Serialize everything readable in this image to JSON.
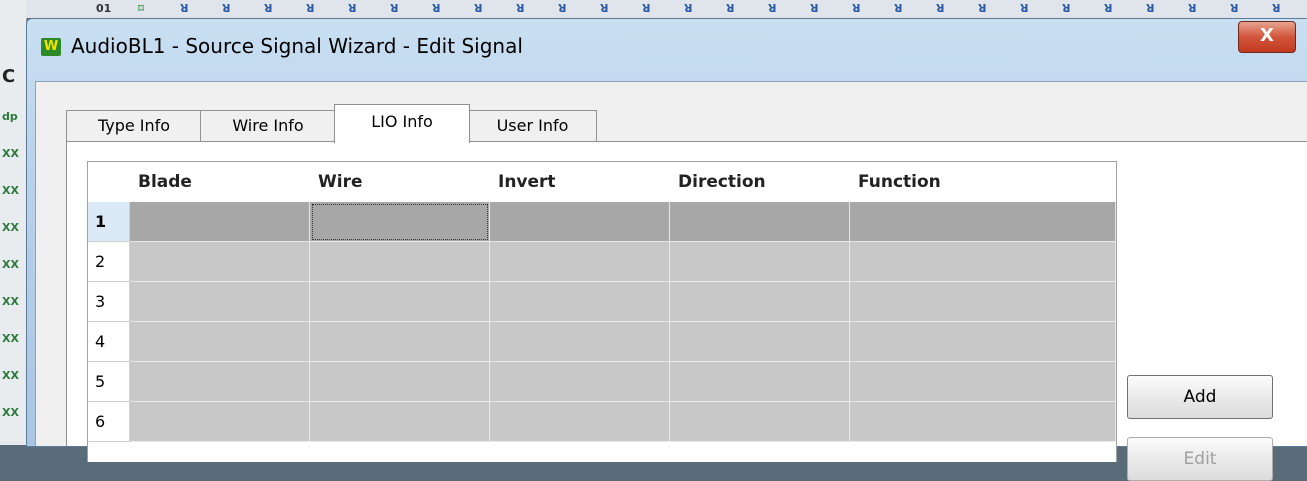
{
  "window": {
    "title": "AudioBL1 - Source Signal Wizard - Edit Signal",
    "app_icon_letter": "W",
    "close_glyph": "X"
  },
  "background": {
    "left_glyphs": [
      "C",
      "dp",
      "XX",
      "XX",
      "XX",
      "XX",
      "XX",
      "XX",
      "XX",
      "XX"
    ],
    "top_pins": [
      "01",
      "⌑",
      "ꓤ",
      "ꓤ",
      "ꓤ",
      "ꓤ",
      "ꓤ",
      "ꓤ",
      "ꓤ",
      "ꓤ",
      "ꓤ",
      "ꓤ",
      "ꓤ",
      "ꓤ",
      "ꓤ",
      "ꓤ",
      "ꓤ",
      "ꓤ",
      "ꓤ",
      "ꓤ",
      "ꓤ",
      "ꓤ",
      "ꓤ",
      "ꓤ",
      "ꓤ",
      "ꓤ",
      "ꓤ",
      "ꓤ",
      "ꓤ"
    ]
  },
  "tabs": [
    {
      "label": "Type Info",
      "active": false
    },
    {
      "label": "Wire Info",
      "active": false
    },
    {
      "label": "LIO Info",
      "active": true
    },
    {
      "label": "User Info",
      "active": false
    }
  ],
  "grid": {
    "columns": [
      "Blade",
      "Wire",
      "Invert",
      "Direction",
      "Function"
    ],
    "rows": [
      {
        "num": "1",
        "cells": [
          "",
          "",
          "",
          "",
          ""
        ],
        "selected": true
      },
      {
        "num": "2",
        "cells": [
          "",
          "",
          "",
          "",
          ""
        ],
        "selected": false
      },
      {
        "num": "3",
        "cells": [
          "",
          "",
          "",
          "",
          ""
        ],
        "selected": false
      },
      {
        "num": "4",
        "cells": [
          "",
          "",
          "",
          "",
          ""
        ],
        "selected": false
      },
      {
        "num": "5",
        "cells": [
          "",
          "",
          "",
          "",
          ""
        ],
        "selected": false
      },
      {
        "num": "6",
        "cells": [
          "",
          "",
          "",
          "",
          ""
        ],
        "selected": false
      }
    ]
  },
  "buttons": {
    "add_label": "Add",
    "edit_label": "Edit"
  },
  "colors": {
    "selected_row": "#a7a7a7",
    "row_fill": "#c8c8c8",
    "close_red": "#c23a1f"
  }
}
